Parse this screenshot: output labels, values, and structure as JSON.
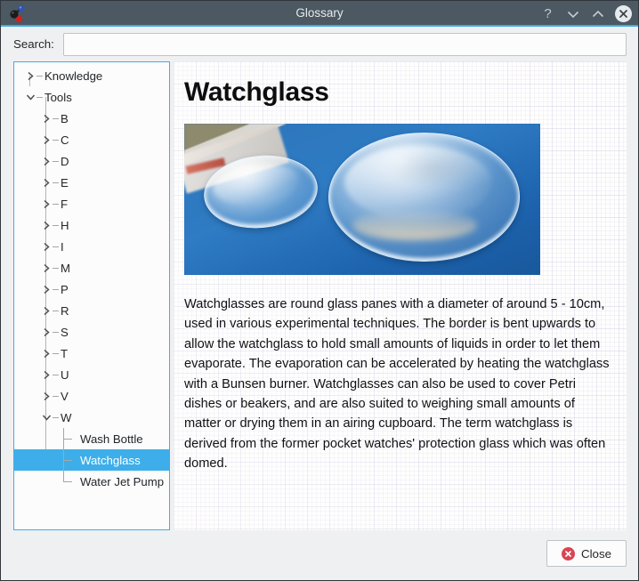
{
  "window": {
    "title": "Glossary",
    "app_icon": "molecule-icon",
    "controls": [
      {
        "name": "help-button",
        "glyph": "?"
      },
      {
        "name": "minimize-button",
        "glyph": "chevron-down-icon"
      },
      {
        "name": "maximize-button",
        "glyph": "chevron-up-icon"
      },
      {
        "name": "close-window-button",
        "glyph": "close-icon"
      }
    ],
    "accent_color": "#3daee9",
    "titlebar_color": "#4c5862"
  },
  "search": {
    "label": "Search:",
    "value": "",
    "placeholder": ""
  },
  "tree": {
    "nodes": [
      {
        "label": "Knowledge",
        "level": 0,
        "state": "collapsed"
      },
      {
        "label": "Tools",
        "level": 0,
        "state": "expanded"
      },
      {
        "label": "B",
        "level": 1,
        "state": "collapsed"
      },
      {
        "label": "C",
        "level": 1,
        "state": "collapsed"
      },
      {
        "label": "D",
        "level": 1,
        "state": "collapsed"
      },
      {
        "label": "E",
        "level": 1,
        "state": "collapsed"
      },
      {
        "label": "F",
        "level": 1,
        "state": "collapsed"
      },
      {
        "label": "H",
        "level": 1,
        "state": "collapsed"
      },
      {
        "label": "I",
        "level": 1,
        "state": "collapsed"
      },
      {
        "label": "M",
        "level": 1,
        "state": "collapsed"
      },
      {
        "label": "P",
        "level": 1,
        "state": "collapsed"
      },
      {
        "label": "R",
        "level": 1,
        "state": "collapsed"
      },
      {
        "label": "S",
        "level": 1,
        "state": "collapsed"
      },
      {
        "label": "T",
        "level": 1,
        "state": "collapsed"
      },
      {
        "label": "U",
        "level": 1,
        "state": "collapsed"
      },
      {
        "label": "V",
        "level": 1,
        "state": "collapsed"
      },
      {
        "label": "W",
        "level": 1,
        "state": "expanded"
      },
      {
        "label": "Wash Bottle",
        "level": 2,
        "state": "leaf",
        "selected": false
      },
      {
        "label": "Watchglass",
        "level": 2,
        "state": "leaf",
        "selected": true
      },
      {
        "label": "Water Jet Pump",
        "level": 2,
        "state": "leaf",
        "selected": false
      }
    ],
    "selection_color": "#3daee9"
  },
  "article": {
    "title": "Watchglass",
    "image_alt": "Two round watchglasses on a blue surface",
    "text": "Watchglasses are round glass panes with a diameter of around 5 - 10cm, used in various experimental techniques. The border is bent upwards to allow the watchglass to hold small amounts of liquids in order to let them evaporate. The evaporation can be accelerated by heating the watchglass with a Bunsen burner. Watchglasses can also be used to cover Petri dishes or beakers, and are also suited to weighing small amounts of matter or drying them in an airing cupboard. The term watchglass is derived from the former pocket watches' protection glass which was often domed."
  },
  "footer": {
    "close_label": "Close",
    "close_icon": "close-circle-icon",
    "close_icon_color": "#da4453"
  }
}
